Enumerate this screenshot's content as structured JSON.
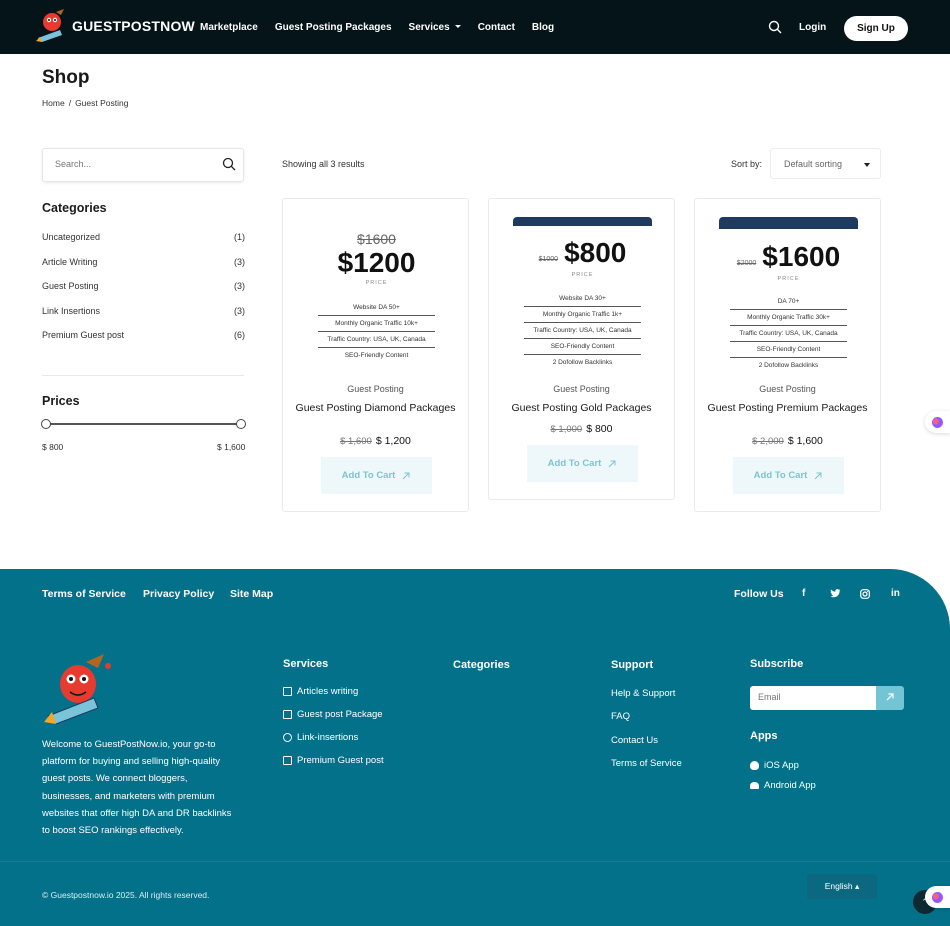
{
  "header": {
    "brand": "GUESTPOSTNOW",
    "nav": [
      "Marketplace",
      "Guest Posting Packages",
      "Services",
      "Contact",
      "Blog"
    ],
    "login_label": "Login",
    "signup_label": "Sign Up"
  },
  "page": {
    "title": "Shop",
    "breadcrumb": {
      "home": "Home",
      "sep": "/",
      "current": "Guest Posting"
    }
  },
  "sidebar": {
    "search_placeholder": "Search...",
    "categories_heading": "Categories",
    "categories": [
      {
        "name": "Uncategorized",
        "count": "(1)"
      },
      {
        "name": "Article Writing",
        "count": "(3)"
      },
      {
        "name": "Guest Posting",
        "count": "(3)"
      },
      {
        "name": "Link Insertions",
        "count": "(3)"
      },
      {
        "name": "Premium Guest post",
        "count": "(6)"
      }
    ],
    "prices_heading": "Prices",
    "price_min": "$ 800",
    "price_max": "$ 1,600",
    "range_fraction": [
      0,
      1
    ]
  },
  "results_bar": {
    "results_text": "Showing all 3 results",
    "sort_label": "Sort by:",
    "sort_value": "Default sorting"
  },
  "products": [
    {
      "img_old_price": "$1600",
      "img_new_price": "$1200",
      "img_caption": "PRICE",
      "features": [
        "Website DA 50+",
        "Monthly Organic Traffic 10k+",
        "Traffic Country: USA, UK, Canada",
        "SEO-Friendly Content"
      ],
      "category": "Guest Posting",
      "title": "Guest Posting Diamond Packages",
      "was_price": "$ 1,600",
      "price": "$ 1,200",
      "cart_label": "Add To Cart"
    },
    {
      "img_old_price": "$1000",
      "img_new_price": "$800",
      "img_caption": "PRICE",
      "features": [
        "Website DA 30+",
        "Monthly Organic Traffic 1k+",
        "Traffic Country: USA, UK, Canada",
        "SEO-Friendly Content",
        "2 Dofollow Backlinks"
      ],
      "category": "Guest Posting",
      "title": "Guest Posting Gold Packages",
      "was_price": "$ 1,000",
      "price": "$ 800",
      "cart_label": "Add To Cart"
    },
    {
      "img_old_price": "$2000",
      "img_new_price": "$1600",
      "img_caption": "PRICE",
      "features": [
        "DA 70+",
        "Monthly Organic Traffic 30k+",
        "Traffic Country: USA, UK, Canada",
        "SEO-Friendly Content",
        "2 Dofollow Backlinks"
      ],
      "category": "Guest Posting",
      "title": "Guest Posting Premium Packages",
      "was_price": "$ 2,000",
      "price": "$ 1,600",
      "cart_label": "Add To Cart"
    }
  ],
  "footer": {
    "links": [
      "Terms of Service",
      "Privacy Policy",
      "Site Map"
    ],
    "follow_label": "Follow Us",
    "social": [
      "f",
      "t",
      "ig",
      "in"
    ],
    "about": "Welcome to GuestPostNow.io, your go-to platform for buying and selling high-quality guest posts. We connect bloggers, businesses, and marketers with premium websites that offer high DA and DR backlinks to boost SEO rankings effectively.",
    "services_heading": "Services",
    "services": [
      "Articles writing",
      "Guest post Package",
      "Link-insertions",
      "Premium Guest post"
    ],
    "categories_heading": "Categories",
    "support_heading": "Support",
    "support": [
      "Help & Support",
      "FAQ",
      "Contact Us",
      "Terms of Service"
    ],
    "subscribe_heading": "Subscribe",
    "email_placeholder": "Email",
    "apps_heading": "Apps",
    "apps": [
      "iOS App",
      "Android App"
    ],
    "copyright": "© Guestpostnow.io 2025. All rights reserved.",
    "language": "English"
  },
  "colors": {
    "header_bg": "#051418",
    "footer_bg": "#04718a",
    "accent": "#7fc3d0",
    "card_band": "#1f3a5f"
  }
}
